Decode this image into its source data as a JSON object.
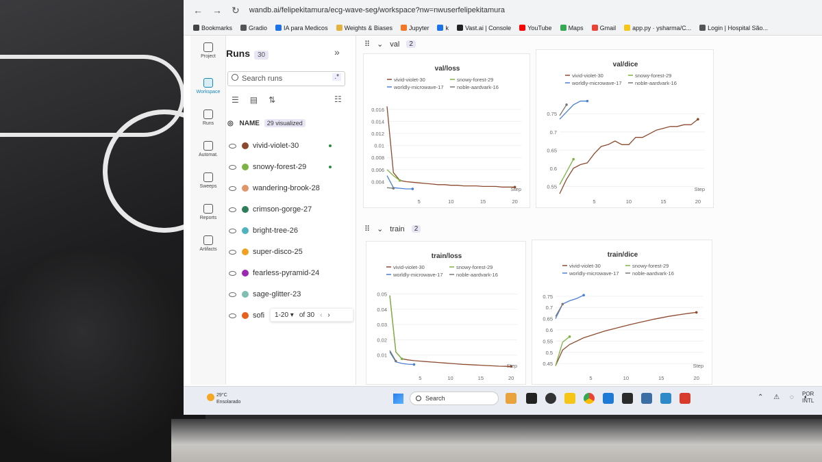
{
  "browser": {
    "url": "wandb.ai/felipekitamura/ecg-wave-seg/workspace?nw=nwuserfelipekitamura",
    "bookmarks": [
      {
        "label": "Bookmarks",
        "color": "#444444"
      },
      {
        "label": "Gradio",
        "color": "#555555"
      },
      {
        "label": "IA para Medicos",
        "color": "#1a73e8"
      },
      {
        "label": "Weights & Biases",
        "color": "#e3b341"
      },
      {
        "label": "Jupyter",
        "color": "#f37726"
      },
      {
        "label": "k",
        "color": "#1a73e8"
      },
      {
        "label": "Vast.ai | Console",
        "color": "#222222"
      },
      {
        "label": "YouTube",
        "color": "#ff0000"
      },
      {
        "label": "Maps",
        "color": "#34a853"
      },
      {
        "label": "Gmail",
        "color": "#ea4335"
      },
      {
        "label": "app.py · ysharma/C...",
        "color": "#f5c518"
      },
      {
        "label": "Login | Hospital São...",
        "color": "#555555"
      }
    ]
  },
  "rail": {
    "items": [
      "Project",
      "Workspace",
      "Runs",
      "Automat.",
      "Sweeps",
      "Reports",
      "Artifacts"
    ]
  },
  "runs_panel": {
    "title": "Runs",
    "count": "30",
    "search_placeholder": "Search runs",
    "regex_label": ".*",
    "name_header": "NAME",
    "visualized_badge": "29 visualized",
    "runs": [
      {
        "name": "vivid-violet-30",
        "color": "#8c4a2f",
        "live": true
      },
      {
        "name": "snowy-forest-29",
        "color": "#7cb342",
        "live": true
      },
      {
        "name": "wandering-brook-28",
        "color": "#e0956b",
        "live": false
      },
      {
        "name": "crimson-gorge-27",
        "color": "#2e7d5b",
        "live": false
      },
      {
        "name": "bright-tree-26",
        "color": "#4fb3bf",
        "live": false
      },
      {
        "name": "super-disco-25",
        "color": "#f0a020",
        "live": false
      },
      {
        "name": "fearless-pyramid-24",
        "color": "#9c27b0",
        "live": false
      },
      {
        "name": "sage-glitter-23",
        "color": "#7fbfb0",
        "live": false
      },
      {
        "name": "sofi",
        "color": "#e8601c",
        "live": false
      }
    ],
    "pager": {
      "range": "1-20 ▾",
      "total": "of 30"
    }
  },
  "sections": [
    {
      "name": "val",
      "count": "2"
    },
    {
      "name": "train",
      "count": "2"
    }
  ],
  "legend": [
    {
      "name": "vivid-violet-30",
      "color": "#8c4a2f"
    },
    {
      "name": "snowy-forest-29",
      "color": "#7cb342"
    },
    {
      "name": "worldly-microwave-17",
      "color": "#4a7fd4"
    },
    {
      "name": "noble-aardvark-16",
      "color": "#777777"
    }
  ],
  "taskbar": {
    "weather_temp": "29°C",
    "weather_desc": "Ensolarado",
    "search_label": "Search",
    "lang_top": "POR",
    "lang_bottom": "INTL"
  },
  "chart_data": [
    {
      "type": "line",
      "title": "val/loss",
      "xlabel": "Step",
      "xlim": [
        0,
        21
      ],
      "ylim": [
        0.002,
        0.017
      ],
      "xticks": [
        5,
        10,
        15,
        20
      ],
      "yticks": [
        0.004,
        0.006,
        0.008,
        0.01,
        0.012,
        0.014,
        0.016
      ],
      "ytick_labels": [
        "0.004",
        "0.006",
        "0.008",
        "0.01",
        "0.012",
        "0.014",
        "0.016"
      ],
      "series": [
        {
          "name": "vivid-violet-30",
          "color": "#8c4a2f",
          "x": [
            0,
            1,
            2,
            3,
            4,
            5,
            6,
            7,
            8,
            9,
            10,
            11,
            12,
            13,
            14,
            15,
            16,
            17,
            18,
            19,
            20
          ],
          "y": [
            0.0165,
            0.0055,
            0.0042,
            0.004,
            0.0039,
            0.0038,
            0.0037,
            0.0036,
            0.0035,
            0.0035,
            0.0034,
            0.0034,
            0.0033,
            0.0033,
            0.0033,
            0.0032,
            0.0032,
            0.0032,
            0.0031,
            0.0031,
            0.0031
          ]
        },
        {
          "name": "snowy-forest-29",
          "color": "#7cb342",
          "x": [
            0,
            1,
            2
          ],
          "y": [
            0.006,
            0.005,
            0.0042
          ]
        },
        {
          "name": "worldly-microwave-17",
          "color": "#4a7fd4",
          "x": [
            0,
            1,
            2,
            3,
            4
          ],
          "y": [
            0.005,
            0.003,
            0.0029,
            0.0028,
            0.0028
          ]
        },
        {
          "name": "noble-aardvark-16",
          "color": "#777777",
          "x": [
            0,
            1
          ],
          "y": [
            0.003,
            0.0029
          ]
        }
      ]
    },
    {
      "type": "line",
      "title": "val/dice",
      "xlabel": "Step",
      "xlim": [
        0,
        21
      ],
      "ylim": [
        0.53,
        0.79
      ],
      "xticks": [
        5,
        10,
        15,
        20
      ],
      "yticks": [
        0.55,
        0.6,
        0.65,
        0.7,
        0.75
      ],
      "ytick_labels": [
        "0.55",
        "0.6",
        "0.65",
        "0.7",
        "0.75"
      ],
      "series": [
        {
          "name": "vivid-violet-30",
          "color": "#8c4a2f",
          "x": [
            0,
            1,
            2,
            3,
            4,
            5,
            6,
            7,
            8,
            9,
            10,
            11,
            12,
            13,
            14,
            15,
            16,
            17,
            18,
            19,
            20
          ],
          "y": [
            0.53,
            0.57,
            0.6,
            0.61,
            0.615,
            0.64,
            0.66,
            0.665,
            0.675,
            0.665,
            0.665,
            0.685,
            0.685,
            0.695,
            0.705,
            0.71,
            0.715,
            0.715,
            0.72,
            0.72,
            0.735
          ]
        },
        {
          "name": "snowy-forest-29",
          "color": "#7cb342",
          "x": [
            0,
            1,
            2
          ],
          "y": [
            0.555,
            0.59,
            0.625
          ]
        },
        {
          "name": "worldly-microwave-17",
          "color": "#4a7fd4",
          "x": [
            0,
            1,
            2,
            3,
            4
          ],
          "y": [
            0.735,
            0.755,
            0.775,
            0.785,
            0.785
          ]
        },
        {
          "name": "noble-aardvark-16",
          "color": "#777777",
          "x": [
            0,
            1
          ],
          "y": [
            0.745,
            0.775
          ]
        }
      ]
    },
    {
      "type": "line",
      "title": "train/loss",
      "xlabel": "Step",
      "xlim": [
        0,
        21
      ],
      "ylim": [
        0,
        0.052
      ],
      "xticks": [
        5,
        10,
        15,
        20
      ],
      "yticks": [
        0.01,
        0.02,
        0.03,
        0.04,
        0.05
      ],
      "ytick_labels": [
        "0.01",
        "0.02",
        "0.03",
        "0.04",
        "0.05"
      ],
      "series": [
        {
          "name": "vivid-violet-30",
          "color": "#8c4a2f",
          "x": [
            0,
            1,
            2,
            3,
            4,
            5,
            6,
            7,
            8,
            9,
            10,
            11,
            12,
            13,
            14,
            15,
            16,
            17,
            18,
            19,
            20
          ],
          "y": [
            0.049,
            0.012,
            0.0075,
            0.0068,
            0.0063,
            0.006,
            0.0057,
            0.0054,
            0.0051,
            0.0048,
            0.0045,
            0.0042,
            0.0039,
            0.0037,
            0.0035,
            0.0033,
            0.0031,
            0.0029,
            0.0027,
            0.0026,
            0.0025
          ]
        },
        {
          "name": "snowy-forest-29",
          "color": "#7cb342",
          "x": [
            0,
            1,
            2
          ],
          "y": [
            0.049,
            0.012,
            0.0075
          ]
        },
        {
          "name": "worldly-microwave-17",
          "color": "#4a7fd4",
          "x": [
            0,
            1,
            2,
            3,
            4
          ],
          "y": [
            0.012,
            0.0055,
            0.0045,
            0.004,
            0.0038
          ]
        },
        {
          "name": "noble-aardvark-16",
          "color": "#777777",
          "x": [
            0,
            1
          ],
          "y": [
            0.013,
            0.006
          ]
        }
      ]
    },
    {
      "type": "line",
      "title": "train/dice",
      "xlabel": "Step",
      "xlim": [
        0,
        21
      ],
      "ylim": [
        0.42,
        0.78
      ],
      "xticks": [
        5,
        10,
        15,
        20
      ],
      "yticks": [
        0.45,
        0.5,
        0.55,
        0.6,
        0.65,
        0.7,
        0.75
      ],
      "ytick_labels": [
        "0.45",
        "0.5",
        "0.55",
        "0.6",
        "0.65",
        "0.7",
        "0.75"
      ],
      "series": [
        {
          "name": "vivid-violet-30",
          "color": "#8c4a2f",
          "x": [
            0,
            1,
            2,
            3,
            4,
            5,
            6,
            7,
            8,
            9,
            10,
            11,
            12,
            13,
            14,
            15,
            16,
            17,
            18,
            19,
            20
          ],
          "y": [
            0.44,
            0.51,
            0.535,
            0.55,
            0.565,
            0.575,
            0.585,
            0.595,
            0.603,
            0.611,
            0.619,
            0.627,
            0.634,
            0.641,
            0.648,
            0.654,
            0.66,
            0.665,
            0.67,
            0.674,
            0.678
          ]
        },
        {
          "name": "snowy-forest-29",
          "color": "#7cb342",
          "x": [
            0,
            1,
            2
          ],
          "y": [
            0.44,
            0.545,
            0.57
          ]
        },
        {
          "name": "worldly-microwave-17",
          "color": "#4a7fd4",
          "x": [
            0,
            1,
            2,
            3,
            4
          ],
          "y": [
            0.65,
            0.715,
            0.73,
            0.74,
            0.755
          ]
        },
        {
          "name": "noble-aardvark-16",
          "color": "#777777",
          "x": [
            0,
            1
          ],
          "y": [
            0.66,
            0.715
          ]
        }
      ]
    }
  ]
}
